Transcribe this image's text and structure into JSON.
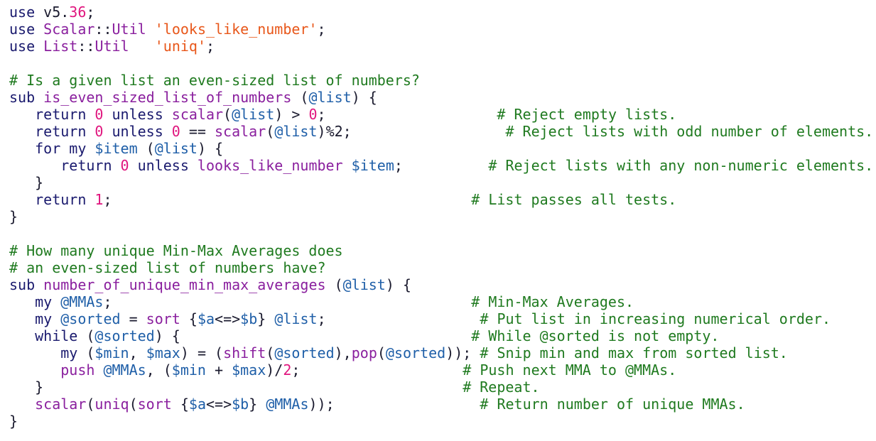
{
  "colors": {
    "keyword": "#1a1a6e",
    "number": "#e0157e",
    "string": "#e8571a",
    "comment": "#1f7a1f",
    "function": "#8a1f9e",
    "variable": "#1f5fa8",
    "plain": "#1a1a2e",
    "background": "#ffffff"
  },
  "code": {
    "lines": [
      [
        [
          "kw",
          "use "
        ],
        [
          "pun",
          "v5."
        ],
        [
          "num",
          "36"
        ],
        [
          "pun",
          ";"
        ]
      ],
      [
        [
          "kw",
          "use "
        ],
        [
          "fn",
          "Scalar"
        ],
        [
          "pun",
          "::"
        ],
        [
          "fn",
          "Util"
        ],
        [
          "pun",
          " "
        ],
        [
          "str",
          "'looks_like_number'"
        ],
        [
          "pun",
          ";"
        ]
      ],
      [
        [
          "kw",
          "use "
        ],
        [
          "fn",
          "List"
        ],
        [
          "pun",
          "::"
        ],
        [
          "fn",
          "Util"
        ],
        [
          "pun",
          "   "
        ],
        [
          "str",
          "'uniq'"
        ],
        [
          "pun",
          ";"
        ]
      ],
      [],
      [
        [
          "com",
          "# Is a given list an even-sized list of numbers?"
        ]
      ],
      [
        [
          "kw",
          "sub "
        ],
        [
          "fn",
          "is_even_sized_list_of_numbers"
        ],
        [
          "pun",
          " ("
        ],
        [
          "var",
          "@list"
        ],
        [
          "pun",
          ") {"
        ]
      ],
      [
        [
          "kw",
          "   return "
        ],
        [
          "num",
          "0"
        ],
        [
          "kw",
          " unless "
        ],
        [
          "fn",
          "scalar"
        ],
        [
          "pun",
          "("
        ],
        [
          "var",
          "@list"
        ],
        [
          "pun",
          ") > "
        ],
        [
          "num",
          "0"
        ],
        [
          "pun",
          ";"
        ],
        [
          "pun",
          "                    "
        ],
        [
          "com",
          "# Reject empty lists."
        ]
      ],
      [
        [
          "kw",
          "   return "
        ],
        [
          "num",
          "0"
        ],
        [
          "kw",
          " unless "
        ],
        [
          "num",
          "0"
        ],
        [
          "pun",
          " == "
        ],
        [
          "fn",
          "scalar"
        ],
        [
          "pun",
          "("
        ],
        [
          "var",
          "@list"
        ],
        [
          "pun",
          ")%2;"
        ],
        [
          "pun",
          "                  "
        ],
        [
          "com",
          "# Reject lists with odd number of elements."
        ]
      ],
      [
        [
          "kw",
          "   for "
        ],
        [
          "kw",
          "my "
        ],
        [
          "var",
          "$item"
        ],
        [
          "pun",
          " ("
        ],
        [
          "var",
          "@list"
        ],
        [
          "pun",
          ") {"
        ]
      ],
      [
        [
          "kw",
          "      return "
        ],
        [
          "num",
          "0"
        ],
        [
          "kw",
          " unless "
        ],
        [
          "fn",
          "looks_like_number"
        ],
        [
          "pun",
          " "
        ],
        [
          "var",
          "$item"
        ],
        [
          "pun",
          ";"
        ],
        [
          "pun",
          "          "
        ],
        [
          "com",
          "# Reject lists with any non-numeric elements."
        ]
      ],
      [
        [
          "pun",
          "   }"
        ]
      ],
      [
        [
          "kw",
          "   return "
        ],
        [
          "num",
          "1"
        ],
        [
          "pun",
          ";"
        ],
        [
          "pun",
          "                                          "
        ],
        [
          "com",
          "# List passes all tests."
        ]
      ],
      [
        [
          "pun",
          "}"
        ]
      ],
      [],
      [
        [
          "com",
          "# How many unique Min-Max Averages does"
        ]
      ],
      [
        [
          "com",
          "# an even-sized list of numbers have?"
        ]
      ],
      [
        [
          "kw",
          "sub "
        ],
        [
          "fn",
          "number_of_unique_min_max_averages"
        ],
        [
          "pun",
          " ("
        ],
        [
          "var",
          "@list"
        ],
        [
          "pun",
          ") {"
        ]
      ],
      [
        [
          "kw",
          "   my "
        ],
        [
          "var",
          "@MMAs"
        ],
        [
          "pun",
          ";"
        ],
        [
          "pun",
          "                                          "
        ],
        [
          "com",
          "# Min-Max Averages."
        ]
      ],
      [
        [
          "kw",
          "   my "
        ],
        [
          "var",
          "@sorted"
        ],
        [
          "pun",
          " = "
        ],
        [
          "fn",
          "sort"
        ],
        [
          "pun",
          " {"
        ],
        [
          "var",
          "$a"
        ],
        [
          "pun",
          "<=>"
        ],
        [
          "var",
          "$b"
        ],
        [
          "pun",
          "} "
        ],
        [
          "var",
          "@list"
        ],
        [
          "pun",
          ";"
        ],
        [
          "pun",
          "                  "
        ],
        [
          "com",
          "# Put list in increasing numerical order."
        ]
      ],
      [
        [
          "kw",
          "   while "
        ],
        [
          "pun",
          "("
        ],
        [
          "var",
          "@sorted"
        ],
        [
          "pun",
          ") {"
        ],
        [
          "pun",
          "                                  "
        ],
        [
          "com",
          "# While @sorted is not empty."
        ]
      ],
      [
        [
          "kw",
          "      my "
        ],
        [
          "pun",
          "("
        ],
        [
          "var",
          "$min"
        ],
        [
          "pun",
          ", "
        ],
        [
          "var",
          "$max"
        ],
        [
          "pun",
          ") = ("
        ],
        [
          "fn",
          "shift"
        ],
        [
          "pun",
          "("
        ],
        [
          "var",
          "@sorted"
        ],
        [
          "pun",
          "),"
        ],
        [
          "fn",
          "pop"
        ],
        [
          "pun",
          "("
        ],
        [
          "var",
          "@sorted"
        ],
        [
          "pun",
          ")); "
        ],
        [
          "com",
          "# Snip min and max from sorted list."
        ]
      ],
      [
        [
          "fn",
          "      push "
        ],
        [
          "var",
          "@MMAs"
        ],
        [
          "pun",
          ", ("
        ],
        [
          "var",
          "$min"
        ],
        [
          "pun",
          " + "
        ],
        [
          "var",
          "$max"
        ],
        [
          "pun",
          ")/"
        ],
        [
          "num",
          "2"
        ],
        [
          "pun",
          ";"
        ],
        [
          "pun",
          "                   "
        ],
        [
          "com",
          "# Push next MMA to @MMAs."
        ]
      ],
      [
        [
          "pun",
          "   }"
        ],
        [
          "pun",
          "                                                 "
        ],
        [
          "com",
          "# Repeat."
        ]
      ],
      [
        [
          "fn",
          "   scalar"
        ],
        [
          "pun",
          "("
        ],
        [
          "fn",
          "uniq"
        ],
        [
          "pun",
          "("
        ],
        [
          "fn",
          "sort"
        ],
        [
          "pun",
          " {"
        ],
        [
          "var",
          "$a"
        ],
        [
          "pun",
          "<=>"
        ],
        [
          "var",
          "$b"
        ],
        [
          "pun",
          "} "
        ],
        [
          "var",
          "@MMAs"
        ],
        [
          "pun",
          "));"
        ],
        [
          "pun",
          "                 "
        ],
        [
          "com",
          "# Return number of unique MMAs."
        ]
      ],
      [
        [
          "pun",
          "}"
        ]
      ]
    ]
  }
}
